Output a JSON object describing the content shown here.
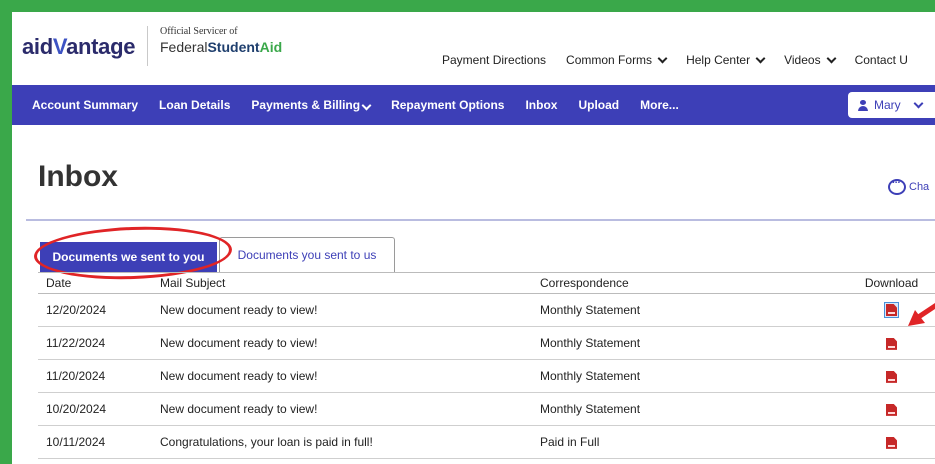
{
  "header": {
    "logo_text": "aidVantage",
    "logo_part1": "aid",
    "logo_part2": "V",
    "logo_part3": "antage",
    "servicer_small": "Official Servicer of",
    "servicer_federal": "Federal",
    "servicer_student": "Student",
    "servicer_aid": "Aid",
    "top_nav": [
      {
        "label": "Payment Directions",
        "dropdown": false
      },
      {
        "label": "Common Forms",
        "dropdown": true
      },
      {
        "label": "Help Center",
        "dropdown": true
      },
      {
        "label": "Videos",
        "dropdown": true
      },
      {
        "label": "Contact U",
        "dropdown": false
      }
    ]
  },
  "main_nav": {
    "items": [
      {
        "label": "Account Summary",
        "dropdown": false
      },
      {
        "label": "Loan Details",
        "dropdown": false
      },
      {
        "label": "Payments & Billing",
        "dropdown": true
      },
      {
        "label": "Repayment Options",
        "dropdown": false
      },
      {
        "label": "Inbox",
        "dropdown": false
      },
      {
        "label": "Upload",
        "dropdown": false
      },
      {
        "label": "More...",
        "dropdown": false
      }
    ],
    "user_name": "Mary"
  },
  "page": {
    "title": "Inbox",
    "chat_label": "Cha"
  },
  "tabs": {
    "active": "Documents we sent to you",
    "inactive": "Documents you sent to us"
  },
  "table": {
    "headers": {
      "date": "Date",
      "subject": "Mail Subject",
      "correspondence": "Correspondence",
      "download": "Download"
    },
    "rows": [
      {
        "date": "12/20/2024",
        "subject": "New document ready to view!",
        "correspondence": "Monthly Statement"
      },
      {
        "date": "11/22/2024",
        "subject": "New document ready to view!",
        "correspondence": "Monthly Statement"
      },
      {
        "date": "11/20/2024",
        "subject": "New document ready to view!",
        "correspondence": "Monthly Statement"
      },
      {
        "date": "10/20/2024",
        "subject": "New document ready to view!",
        "correspondence": "Monthly Statement"
      },
      {
        "date": "10/11/2024",
        "subject": "Congratulations, your loan is paid in full!",
        "correspondence": "Paid in Full"
      }
    ]
  },
  "colors": {
    "border_green": "#3aa84a",
    "nav_blue": "#3d3fb7",
    "annotation_red": "#e02426"
  }
}
